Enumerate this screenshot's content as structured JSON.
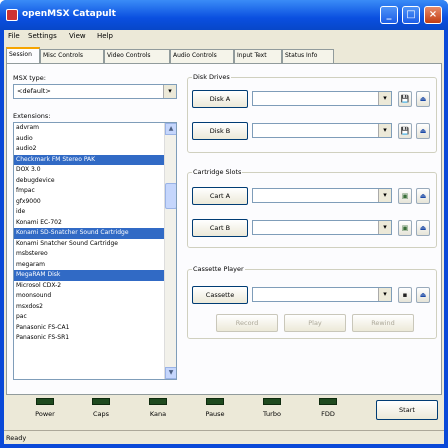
{
  "window": {
    "title": "openMSX Catapult"
  },
  "menus": [
    "File",
    "Settings",
    "View",
    "Help"
  ],
  "tabs": [
    "Session",
    "Misc Controls",
    "Video Controls",
    "Audio Controls",
    "Input Text",
    "Status Info"
  ],
  "session": {
    "msx_type_label": "MSX type:",
    "msx_type_value": "<default>",
    "extensions_label": "Extensions:",
    "extensions": [
      {
        "name": "advram",
        "selected": false
      },
      {
        "name": "audio",
        "selected": false
      },
      {
        "name": "audio2",
        "selected": false
      },
      {
        "name": "Checkmark FM Stereo PAK",
        "selected": true
      },
      {
        "name": "DOX 3.0",
        "selected": false
      },
      {
        "name": "debugdevice",
        "selected": false
      },
      {
        "name": "fmpac",
        "selected": false
      },
      {
        "name": "gfx9000",
        "selected": false
      },
      {
        "name": "ide",
        "selected": false
      },
      {
        "name": "Konami EC-702",
        "selected": false
      },
      {
        "name": "Konami SD-Snatcher Sound Cartridge",
        "selected": true
      },
      {
        "name": "Konami Snatcher Sound Cartridge",
        "selected": false
      },
      {
        "name": "msbstereo",
        "selected": false
      },
      {
        "name": "megaram",
        "selected": false
      },
      {
        "name": "MegaRAM Disk",
        "selected": true
      },
      {
        "name": "Microsol CDX-2",
        "selected": false
      },
      {
        "name": "moonsound",
        "selected": false
      },
      {
        "name": "msxdos2",
        "selected": false
      },
      {
        "name": "pac",
        "selected": false
      },
      {
        "name": "Panasonic FS-CA1",
        "selected": false
      },
      {
        "name": "Panasonic FS-SR1",
        "selected": false
      }
    ],
    "disk_drives_label": "Disk Drives",
    "disk_a_label": "Disk A",
    "disk_b_label": "Disk B",
    "disk_a_value": "",
    "disk_b_value": "",
    "cartridge_slots_label": "Cartridge Slots",
    "cart_a_label": "Cart A",
    "cart_b_label": "Cart B",
    "cart_a_value": "",
    "cart_b_value": "",
    "cassette_player_label": "Cassette Player",
    "cassette_label": "Cassette",
    "cassette_value": "",
    "record_label": "Record",
    "play_label": "Play",
    "rewind_label": "Rewind"
  },
  "leds": [
    "Power",
    "Caps",
    "Kana",
    "Pause",
    "Turbo",
    "FDD"
  ],
  "start_label": "Start",
  "status_text": "Ready",
  "colors": {
    "titlebar": "#0a4fe0",
    "selection": "#316ac5",
    "led_off": "#1f4a1f",
    "active_tab_accent": "#f6a400"
  }
}
